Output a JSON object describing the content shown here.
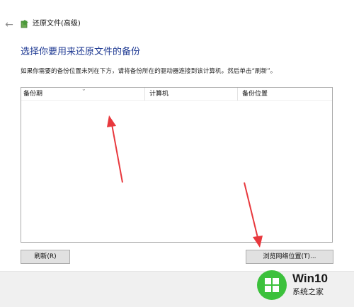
{
  "window": {
    "title": "还原文件(高级)",
    "back_icon": "back-arrow-icon",
    "title_icon": "backup-restore-icon"
  },
  "main": {
    "heading": "选择你要用来还原文件的备份",
    "instruction": "如果你需要的备份位置未列在下方，请将备份所在的驱动器连接到该计算机，然后单击“刷新”。"
  },
  "backup_list": {
    "columns": [
      "备份期",
      "计算机",
      "备份位置"
    ],
    "sorted_column": 0,
    "rows": []
  },
  "buttons": {
    "refresh": "刷新(R)",
    "browse_network": "浏览网络位置(T)..."
  },
  "annotations": {
    "arrow_color": "#e8383d"
  },
  "watermark": {
    "brand": "Win10",
    "site": "系统之家",
    "logo_color": "#3cc13c"
  },
  "colors": {
    "heading": "#1f3a93",
    "footer_bg": "#f0f0f0",
    "button_bg": "#e1e1e1"
  }
}
